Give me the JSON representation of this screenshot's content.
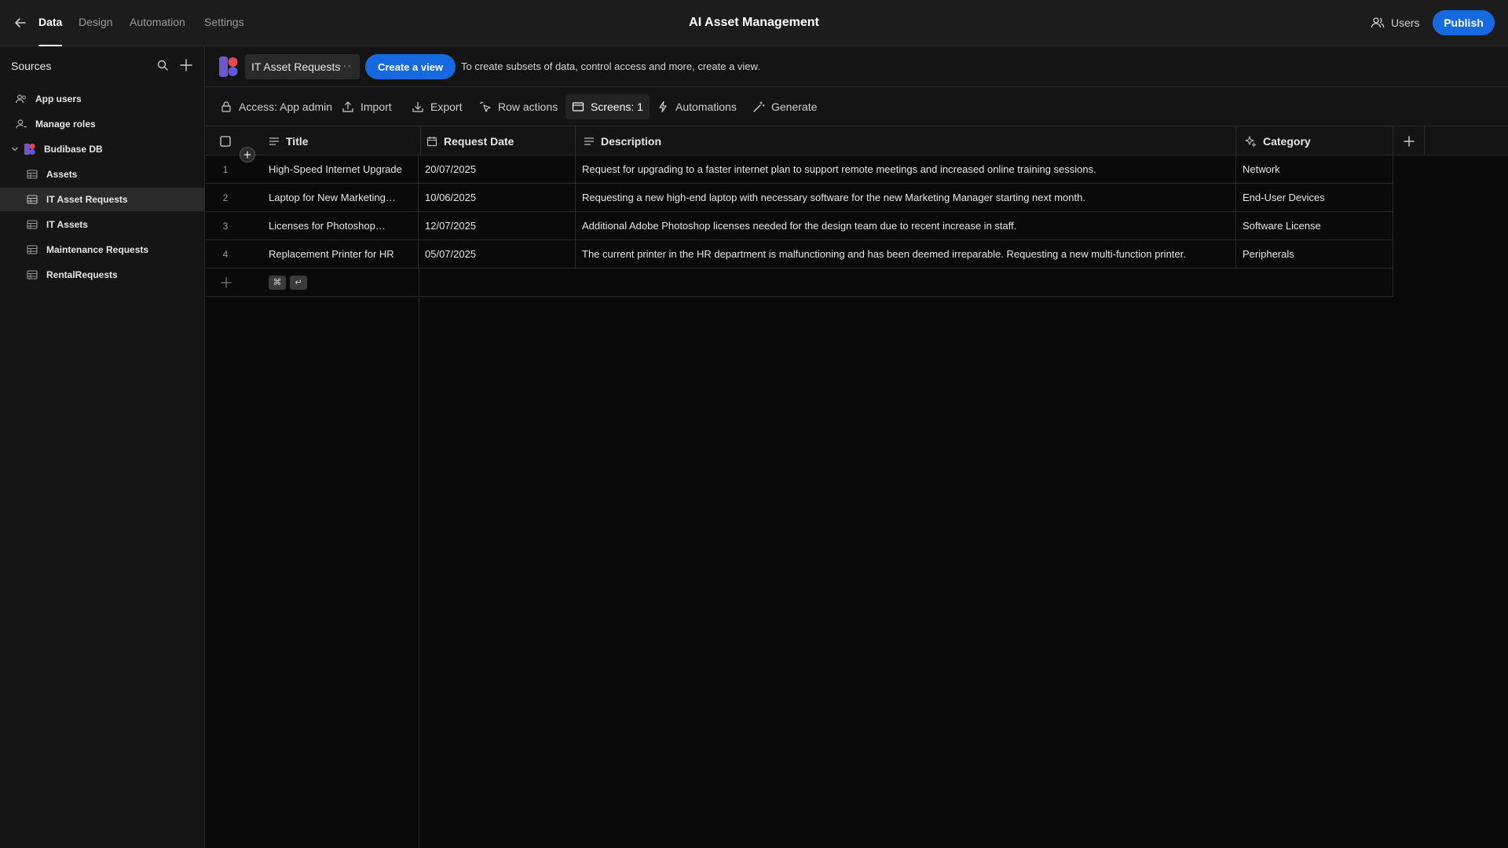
{
  "topbar": {
    "tabs": [
      {
        "label": "Data",
        "active": true
      },
      {
        "label": "Design",
        "active": false
      },
      {
        "label": "Automation",
        "active": false
      },
      {
        "label": "Settings",
        "active": false
      }
    ],
    "app_title": "AI Asset Management",
    "users_label": "Users",
    "publish_label": "Publish",
    "accent_color": "#1769e0"
  },
  "sidebar": {
    "header": "Sources",
    "items": [
      {
        "label": "App users",
        "icon": "app-users-icon"
      },
      {
        "label": "Manage roles",
        "icon": "roles-icon"
      },
      {
        "label": "Budibase DB",
        "icon": "budibase-db-icon",
        "expanded": true
      },
      {
        "label": "Assets",
        "icon": "table-icon"
      },
      {
        "label": "IT Asset Requests",
        "icon": "table-icon",
        "selected": true
      },
      {
        "label": "IT Assets",
        "icon": "table-icon"
      },
      {
        "label": "Maintenance Requests",
        "icon": "table-icon"
      },
      {
        "label": "RentalRequests",
        "icon": "table-icon"
      }
    ]
  },
  "tablebar": {
    "table_name": "IT Asset Requests",
    "more_label": "···",
    "create_view_label": "Create a view",
    "hint": "To create subsets of data, control access and more, create a view."
  },
  "toolbar": {
    "access": "Access: App admin",
    "import": "Import",
    "export": "Export",
    "row_actions": "Row actions",
    "screens": "Screens: 1",
    "automations": "Automations",
    "generate": "Generate"
  },
  "grid": {
    "columns": [
      {
        "label": "Title",
        "icon": "text-icon"
      },
      {
        "label": "Request Date",
        "icon": "calendar-icon"
      },
      {
        "label": "Description",
        "icon": "text-icon"
      },
      {
        "label": "Category",
        "icon": "ai-category-icon"
      }
    ],
    "rows": [
      {
        "num": "1",
        "title": "High-Speed Internet Upgrade",
        "date": "20/07/2025",
        "description": "Request for upgrading to a faster internet plan to support remote meetings and increased online training sessions.",
        "category": "Network"
      },
      {
        "num": "2",
        "title": "Laptop for New Marketing…",
        "date": "10/06/2025",
        "description": "Requesting a new high-end laptop with necessary software for the new Marketing Manager starting next month.",
        "category": "End-User Devices"
      },
      {
        "num": "3",
        "title": "Licenses for Photoshop…",
        "date": "12/07/2025",
        "description": "Additional Adobe Photoshop licenses needed for the design team due to recent increase in staff.",
        "category": "Software License"
      },
      {
        "num": "4",
        "title": "Replacement Printer for HR",
        "date": "05/07/2025",
        "description": "The current printer in the HR department is malfunctioning and has been deemed irreparable. Requesting a new multi-function printer.",
        "category": "Peripherals"
      }
    ],
    "new_row_keys": [
      "⌘",
      "↵"
    ]
  }
}
